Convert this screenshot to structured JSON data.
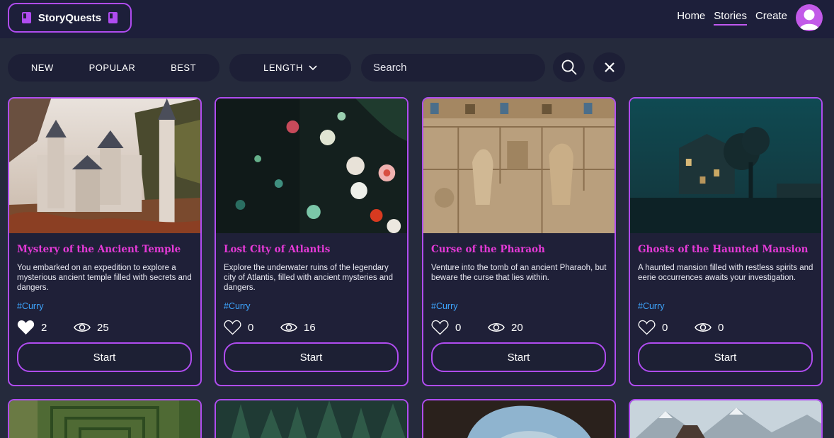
{
  "header": {
    "logo_text": "StoryQuests",
    "nav": [
      "Home",
      "Stories",
      "Create"
    ],
    "active_nav": "Stories"
  },
  "filters": {
    "sort_options": [
      "NEW",
      "POPULAR",
      "BEST"
    ],
    "length_label": "LENGTH",
    "search_placeholder": "Search"
  },
  "colors": {
    "accent": "#b04cf0",
    "title": "#e63ad8",
    "tag": "#3ea6ff",
    "background": "#252a3c"
  },
  "start_label": "Start",
  "stories": [
    {
      "title": "Mystery of the Ancient Temple",
      "description": "You embarked on an expedition to explore a mysterious ancient temple filled with secrets and dangers.",
      "tag": "#Curry",
      "likes": "2",
      "views": "25",
      "liked": true,
      "image": "castle"
    },
    {
      "title": "Lost City of Atlantis",
      "description": "Explore the underwater ruins of the legendary city of Atlantis, filled with ancient mysteries and dangers.",
      "tag": "#Curry",
      "likes": "0",
      "views": "16",
      "liked": false,
      "image": "underwater-flowers"
    },
    {
      "title": "Curse of the Pharaoh",
      "description": "Venture into the tomb of an ancient Pharaoh, but beware the curse that lies within.",
      "tag": "#Curry",
      "likes": "0",
      "views": "20",
      "liked": false,
      "image": "hieroglyph-wall"
    },
    {
      "title": "Ghosts of the Haunted Mansion",
      "description": "A haunted mansion filled with restless spirits and eerie occurrences awaits your investigation.",
      "tag": "#Curry",
      "likes": "0",
      "views": "0",
      "liked": false,
      "image": "foggy-mansion"
    }
  ],
  "second_row_images": [
    "hedge-maze",
    "pine-forest",
    "cave-opening",
    "snowy-mountains"
  ]
}
